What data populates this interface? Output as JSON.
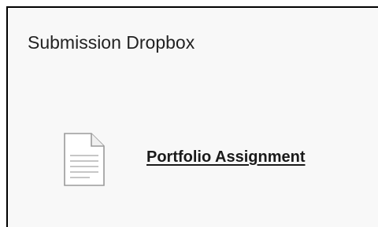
{
  "dropbox": {
    "title": "Submission Dropbox",
    "items": [
      {
        "icon": "document-icon",
        "label": "Portfolio Assignment"
      }
    ]
  }
}
